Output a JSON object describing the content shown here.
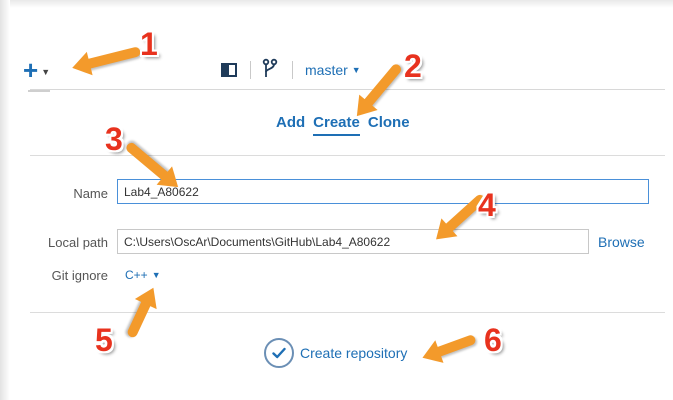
{
  "toolbar": {
    "add_menu_icon": "plus-icon",
    "branch": "master"
  },
  "tabs": [
    {
      "label": "Add",
      "active": false
    },
    {
      "label": "Create",
      "active": true
    },
    {
      "label": "Clone",
      "active": false
    }
  ],
  "form": {
    "name_label": "Name",
    "name_value": "Lab4_A80622",
    "path_label": "Local path",
    "path_value": "C:\\Users\\OscAr\\Documents\\GitHub\\Lab4_A80622",
    "browse_label": "Browse",
    "gitignore_label": "Git ignore",
    "gitignore_value": "C++"
  },
  "create_button": {
    "label": "Create repository",
    "icon": "check-circle-icon"
  },
  "annotations": [
    "1",
    "2",
    "3",
    "4",
    "5",
    "6"
  ],
  "colors": {
    "accent": "#1e6fb5",
    "annotation_arrow": "#f39a2b",
    "annotation_number": "#e8321e"
  }
}
